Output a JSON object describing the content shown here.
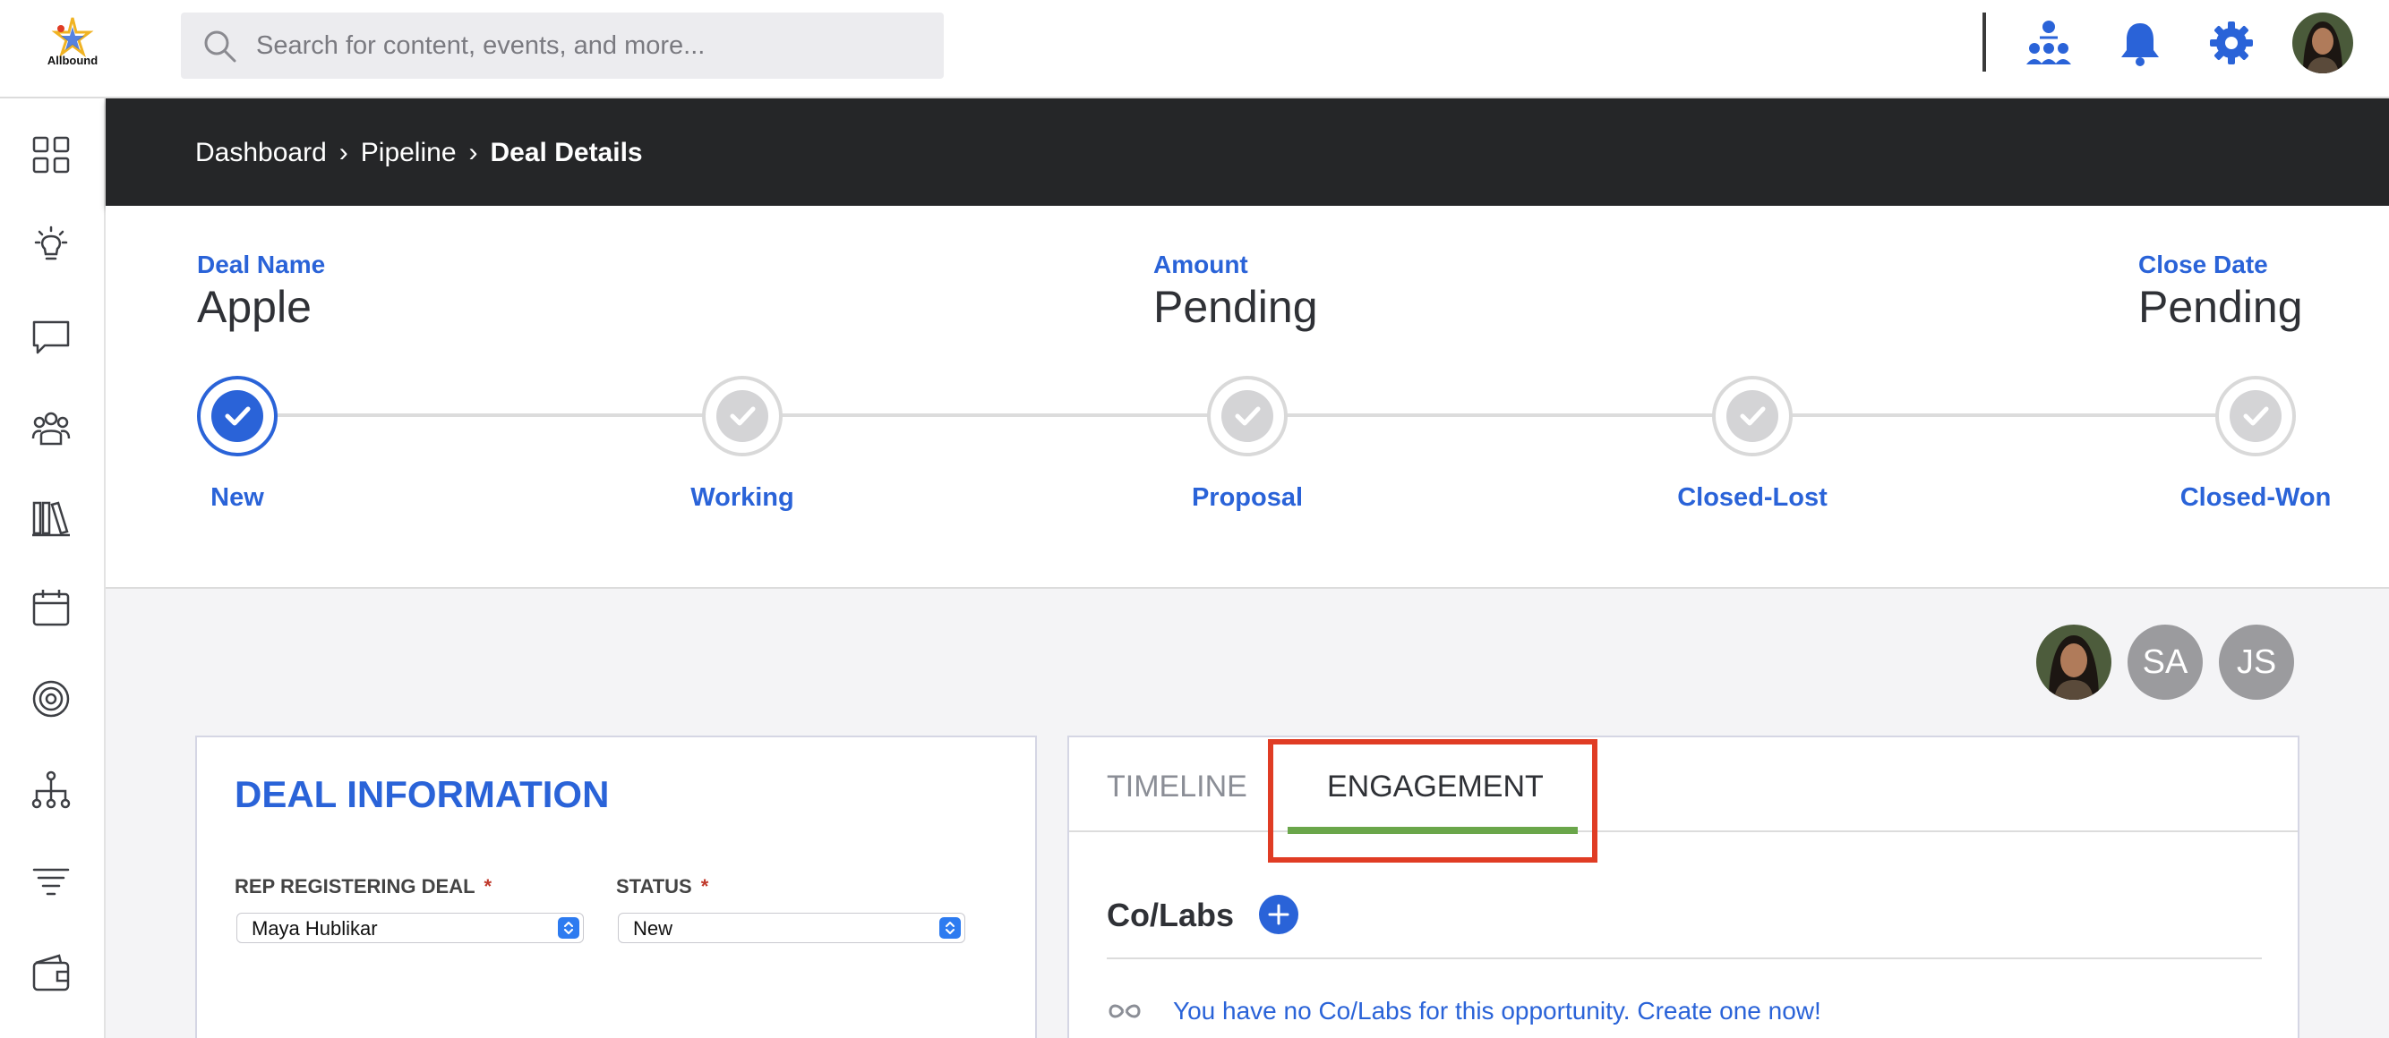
{
  "app": {
    "logo_text": "Allbound"
  },
  "search": {
    "placeholder": "Search for content, events, and more..."
  },
  "breadcrumb": {
    "items": [
      "Dashboard",
      "Pipeline",
      "Deal Details"
    ],
    "separator": "›"
  },
  "deal": {
    "name_label": "Deal Name",
    "name_value": "Apple",
    "amount_label": "Amount",
    "amount_value": "Pending",
    "close_label": "Close Date",
    "close_value": "Pending"
  },
  "stages": [
    {
      "label": "New",
      "active": true
    },
    {
      "label": "Working",
      "active": false
    },
    {
      "label": "Proposal",
      "active": false
    },
    {
      "label": "Closed-Lost",
      "active": false
    },
    {
      "label": "Closed-Won",
      "active": false
    }
  ],
  "team": {
    "initials": [
      "SA",
      "JS"
    ]
  },
  "deal_info": {
    "title": "DEAL INFORMATION",
    "rep_label": "REP REGISTERING DEAL",
    "rep_value": "Maya Hublikar",
    "status_label": "STATUS",
    "status_value": "New",
    "required_mark": "*"
  },
  "engagement": {
    "tabs": [
      "TIMELINE",
      "ENGAGEMENT"
    ],
    "active_tab": "ENGAGEMENT",
    "colabs_title": "Co/Labs",
    "colabs_empty": "You have no Co/Labs for this opportunity. Create one now!"
  },
  "colors": {
    "accent": "#2a63d8",
    "tab_underline": "#6aa64a",
    "highlight": "#e03c24",
    "header_dark": "#252628"
  },
  "icons": {
    "top": [
      "org-chart-icon",
      "bell-icon",
      "gear-icon"
    ],
    "sidebar": [
      "dashboard-icon",
      "lightbulb-icon",
      "chat-icon",
      "people-icon",
      "library-icon",
      "calendar-icon",
      "target-icon",
      "hierarchy-icon",
      "filter-icon",
      "wallet-icon"
    ]
  }
}
